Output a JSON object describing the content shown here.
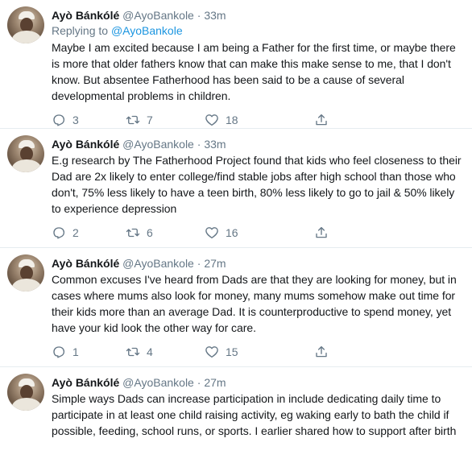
{
  "tweets": [
    {
      "name": "Ayò Bánkólé",
      "handle": "@AyoBankole",
      "separator": "·",
      "time": "33m",
      "replying_prefix": "Replying to",
      "replying_to": "@AyoBankole",
      "text": "Maybe I am excited because I am being a Father for the first time, or maybe there is more that older fathers know that can make this make sense to me, that I don't know. But absentee Fatherhood has been said to be a cause of several developmental problems in children.",
      "replies": "3",
      "retweets": "7",
      "likes": "18"
    },
    {
      "name": "Ayò Bánkólé",
      "handle": "@AyoBankole",
      "separator": "·",
      "time": "33m",
      "text": "E.g research by The Fatherhood Project found that kids who feel closeness to their Dad are 2x likely to enter college/find stable jobs after high school than those who don't, 75% less likely to have a teen birth, 80% less likely to go to jail & 50% likely to experience depression",
      "replies": "2",
      "retweets": "6",
      "likes": "16"
    },
    {
      "name": "Ayò Bánkólé",
      "handle": "@AyoBankole",
      "separator": "·",
      "time": "27m",
      "text": "Common excuses I've heard from Dads are that they are looking for money, but in cases where mums also look for money, many mums somehow make out time for their kids more than an average Dad. It is counterproductive to spend money, yet have your kid look the other way for care.",
      "replies": "1",
      "retweets": "4",
      "likes": "15"
    },
    {
      "name": "Ayò Bánkólé",
      "handle": "@AyoBankole",
      "separator": "·",
      "time": "27m",
      "text": "Simple ways Dads can increase participation in include dedicating daily time to participate in at least one child raising activity, eg waking early to bath the child if possible, feeding, school runs, or sports. I earlier shared how to support after birth"
    }
  ],
  "icons": {
    "reply": "reply-icon",
    "retweet": "retweet-icon",
    "like": "heart-icon",
    "share": "share-icon"
  },
  "colors": {
    "link": "#1b95e0",
    "secondary_text": "#657786",
    "divider": "#e6ecf0"
  }
}
